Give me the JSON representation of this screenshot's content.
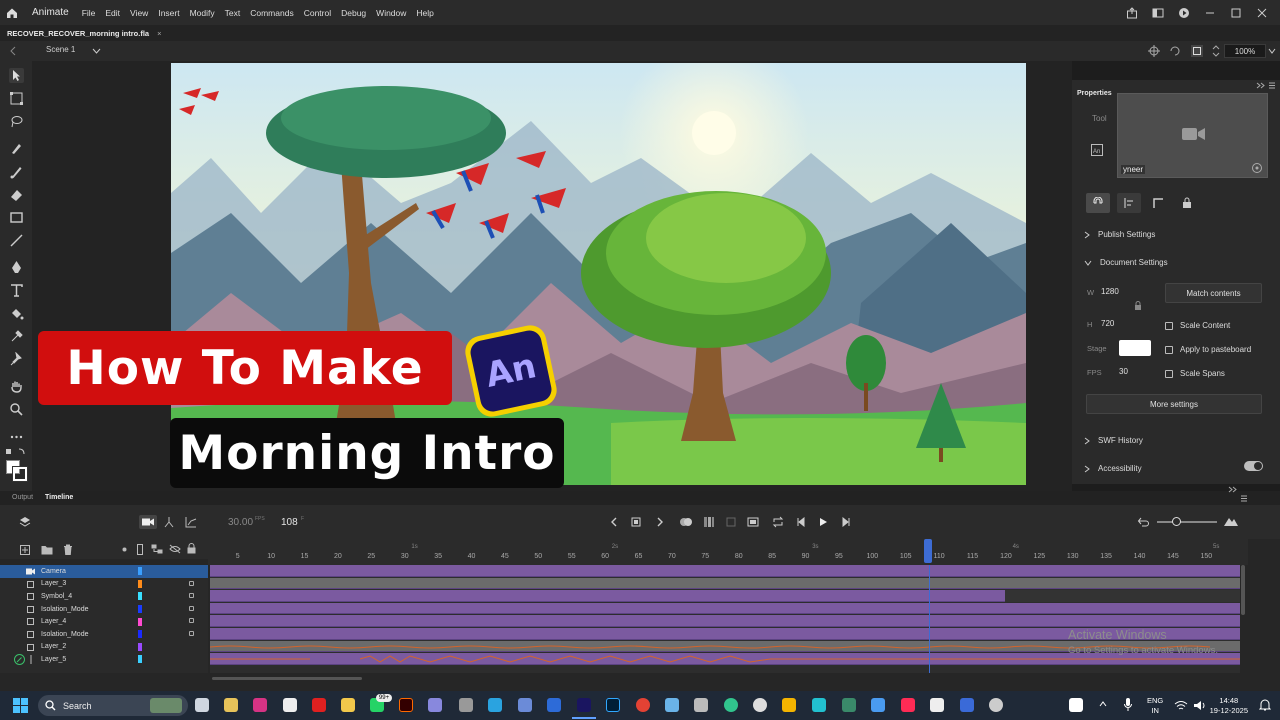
{
  "menubar": {
    "app_name": "Animate",
    "items": [
      "File",
      "Edit",
      "View",
      "Insert",
      "Modify",
      "Text",
      "Commands",
      "Control",
      "Debug",
      "Window",
      "Help"
    ]
  },
  "doc_tab": {
    "filename": "RECOVER_RECOVER_morning intro.fla",
    "close": "×"
  },
  "scenebar": {
    "scene": "Scene 1",
    "zoom": "100%"
  },
  "properties": {
    "title": "Properties",
    "tool_label": "Tool",
    "camera_name": "yneer",
    "publish_settings": "Publish Settings",
    "document_settings": "Document Settings",
    "w_label": "W",
    "w_value": "1280",
    "h_label": "H",
    "h_value": "720",
    "stage_label": "Stage",
    "fps_label": "FPS",
    "fps_value": "30",
    "match_contents": "Match contents",
    "scale_content": "Scale Content",
    "apply_pasteboard": "Apply to pasteboard",
    "scale_spans": "Scale Spans",
    "more_settings": "More settings",
    "swf_history": "SWF History",
    "accessibility": "Accessibility"
  },
  "timeline": {
    "tab_output": "Output",
    "tab_timeline": "Timeline",
    "fps_display": "30.00",
    "fps_unit": "FPS",
    "frame_display": "108",
    "frame_unit": "F",
    "playhead_frame": 108,
    "ruler_numbers": [
      "5",
      "10",
      "15",
      "20",
      "25",
      "30",
      "35",
      "40",
      "45",
      "50",
      "55",
      "60",
      "65",
      "70",
      "75",
      "80",
      "85",
      "90",
      "95",
      "100",
      "105",
      "110",
      "115",
      "120",
      "125",
      "130",
      "135",
      "140",
      "145",
      "150"
    ],
    "second_marks": [
      "1s",
      "2s",
      "3s",
      "4s",
      "5s"
    ],
    "layers": [
      {
        "name": "Camera",
        "color": "#3aa0ff"
      },
      {
        "name": "Layer_3",
        "color": "#ff8c1a"
      },
      {
        "name": "Symbol_4",
        "color": "#39e0ff"
      },
      {
        "name": "Isolation_Mode",
        "color": "#1a3cff"
      },
      {
        "name": "Layer_4",
        "color": "#ff4ad0"
      },
      {
        "name": "Isolation_Mode",
        "color": "#1a2aff"
      },
      {
        "name": "Layer_2",
        "color": "#9a4aff"
      },
      {
        "name": "Layer_5",
        "color": "#3ad0ff"
      }
    ]
  },
  "overlay": {
    "headline1": "How To Make",
    "headline2": "Morning Intro",
    "logo_text": "An"
  },
  "watermark": {
    "line1": "Activate Windows",
    "line2": "Go to Settings to activate Windows."
  },
  "taskbar": {
    "search_placeholder": "Search",
    "badge": "99+",
    "lang_top": "ENG",
    "lang_bottom": "IN",
    "time": "14:48",
    "date": "19-12-2025"
  }
}
